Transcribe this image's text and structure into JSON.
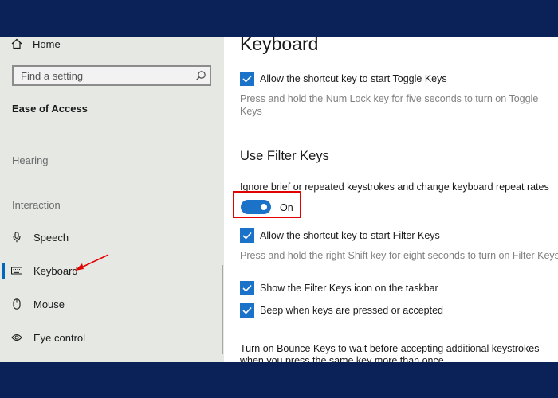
{
  "sidebar": {
    "home_label": "Home",
    "search_placeholder": "Find a setting",
    "category": "Ease of Access",
    "groups": {
      "hearing": "Hearing",
      "interaction": "Interaction"
    },
    "items": [
      {
        "label": "Speech",
        "icon": "microphone-icon"
      },
      {
        "label": "Keyboard",
        "icon": "keyboard-icon",
        "selected": true
      },
      {
        "label": "Mouse",
        "icon": "mouse-icon"
      },
      {
        "label": "Eye control",
        "icon": "eye-control-icon"
      }
    ]
  },
  "content": {
    "title": "Keyboard",
    "toggle_keys_shortcut": {
      "label": "Allow the shortcut key to start Toggle Keys",
      "checked": true
    },
    "toggle_keys_desc": "Press and hold the Num Lock key for five seconds to turn on Toggle Keys",
    "filter_keys": {
      "title": "Use Filter Keys",
      "description": "Ignore brief or repeated keystrokes and change keyboard repeat rates",
      "toggle_state": "On",
      "shortcut": {
        "label": "Allow the shortcut key to start Filter Keys",
        "checked": true
      },
      "shortcut_desc": "Press and hold the right Shift key for eight seconds to turn on Filter Keys",
      "show_icon": {
        "label": "Show the Filter Keys icon on the taskbar",
        "checked": true
      },
      "beep": {
        "label": "Beep when keys are pressed or accepted",
        "checked": true
      }
    },
    "bounce_keys_text": "Turn on Bounce Keys to wait before accepting additional keystrokes when you press the same key more than once"
  },
  "colors": {
    "accent": "#1a73c8",
    "highlight": "#e30000",
    "frame": "#0b2259"
  }
}
